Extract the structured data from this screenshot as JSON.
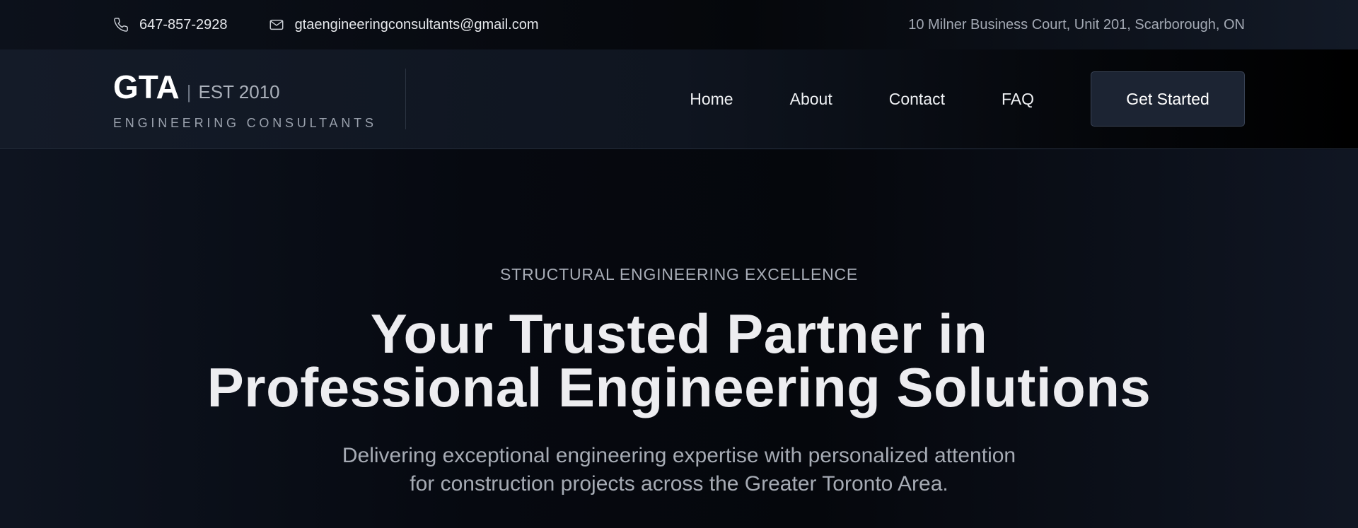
{
  "topbar": {
    "phone": "647-857-2928",
    "email": "gtaengineeringconsultants@gmail.com",
    "address": "10 Milner Business Court, Unit 201, Scarborough, ON",
    "icons": [
      "phone-icon",
      "mail-icon"
    ]
  },
  "header": {
    "logo": {
      "name": "GTA",
      "separator": "|",
      "established": "EST 2010",
      "tagline": "ENGINEERING CONSULTANTS"
    },
    "nav": [
      {
        "label": "Home"
      },
      {
        "label": "About"
      },
      {
        "label": "Contact"
      },
      {
        "label": "FAQ"
      }
    ],
    "cta_label": "Get Started"
  },
  "hero": {
    "eyebrow": "STRUCTURAL ENGINEERING EXCELLENCE",
    "headline_line1": "Your Trusted Partner in",
    "headline_line2": "Professional Engineering Solutions",
    "subtext_line1": "Delivering exceptional engineering expertise with personalized attention",
    "subtext_line2": "for construction projects across the Greater Toronto Area."
  },
  "colors": {
    "background": "#06090f",
    "cta_background": "#1c2433",
    "text_primary": "#ededf0",
    "text_muted": "#a6abb4"
  }
}
